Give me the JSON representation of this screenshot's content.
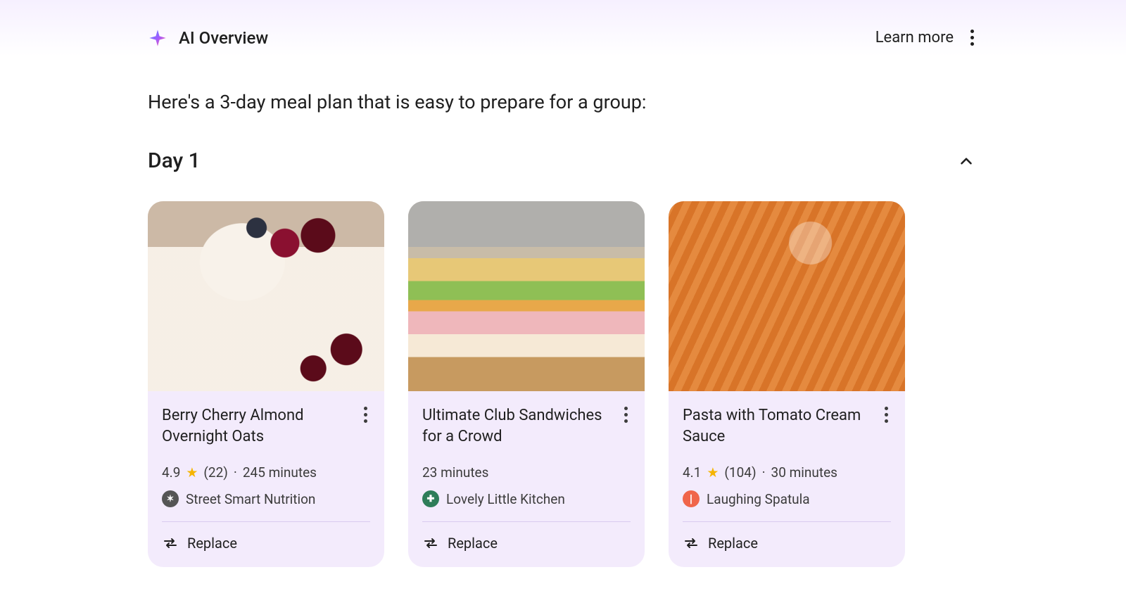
{
  "header": {
    "title": "AI Overview",
    "learn_more": "Learn more"
  },
  "intro": "Here's a 3-day meal plan that is easy to prepare for a group:",
  "day_label": "Day 1",
  "replace_label": "Replace",
  "cards": [
    {
      "title": "Berry Cherry Almond Overnight Oats",
      "rating": "4.9",
      "reviews": "(22)",
      "duration": "245 minutes",
      "source": "Street Smart Nutrition",
      "has_rating": true
    },
    {
      "title": "Ultimate Club Sandwiches for a Crowd",
      "duration": "23 minutes",
      "source": "Lovely Little Kitchen",
      "has_rating": false
    },
    {
      "title": "Pasta with Tomato Cream Sauce",
      "rating": "4.1",
      "reviews": "(104)",
      "duration": "30 minutes",
      "source": "Laughing Spatula",
      "has_rating": true
    }
  ]
}
